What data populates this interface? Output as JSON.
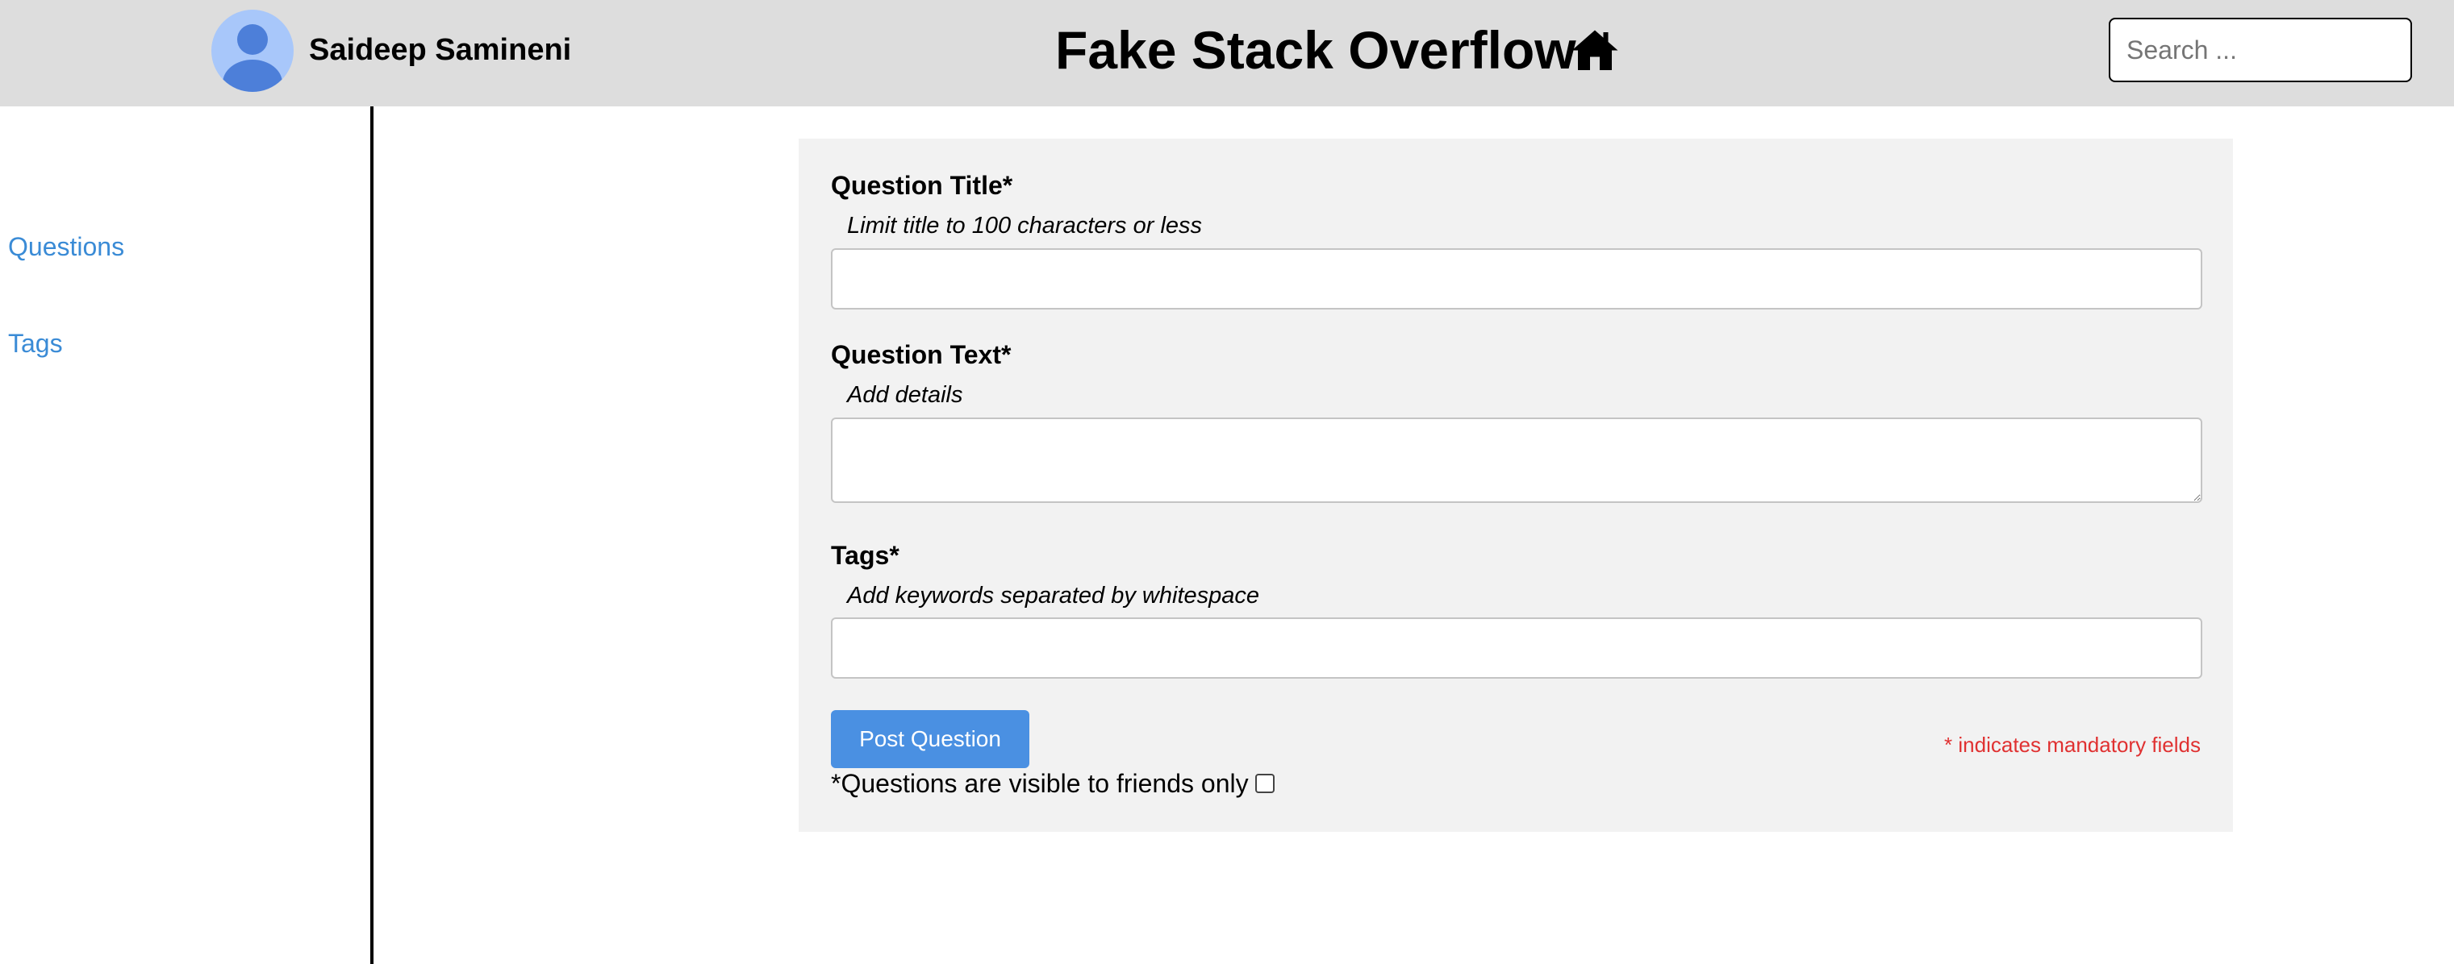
{
  "header": {
    "username": "Saideep Samineni",
    "site_title": "Fake Stack Overflow",
    "search_placeholder": "Search ..."
  },
  "sidebar": {
    "items": [
      {
        "label": "Questions"
      },
      {
        "label": "Tags"
      }
    ]
  },
  "form": {
    "title_label": "Question Title*",
    "title_hint": "Limit title to 100 characters or less",
    "title_value": "",
    "text_label": "Question Text*",
    "text_hint": "Add details",
    "text_value": "",
    "tags_label": "Tags*",
    "tags_hint": "Add keywords separated by whitespace",
    "tags_value": "",
    "post_button_label": "Post Question",
    "mandatory_note": "* indicates mandatory fields",
    "visibility_label": "*Questions are visible to friends only",
    "visibility_checked": false
  },
  "colors": {
    "header_bg": "#dddddd",
    "link": "#3a8bd6",
    "button": "#4a90e2",
    "panel_bg": "#f2f2f2",
    "mandatory": "#e03131"
  },
  "icons": {
    "avatar": "user-avatar-icon",
    "home": "home-icon"
  }
}
